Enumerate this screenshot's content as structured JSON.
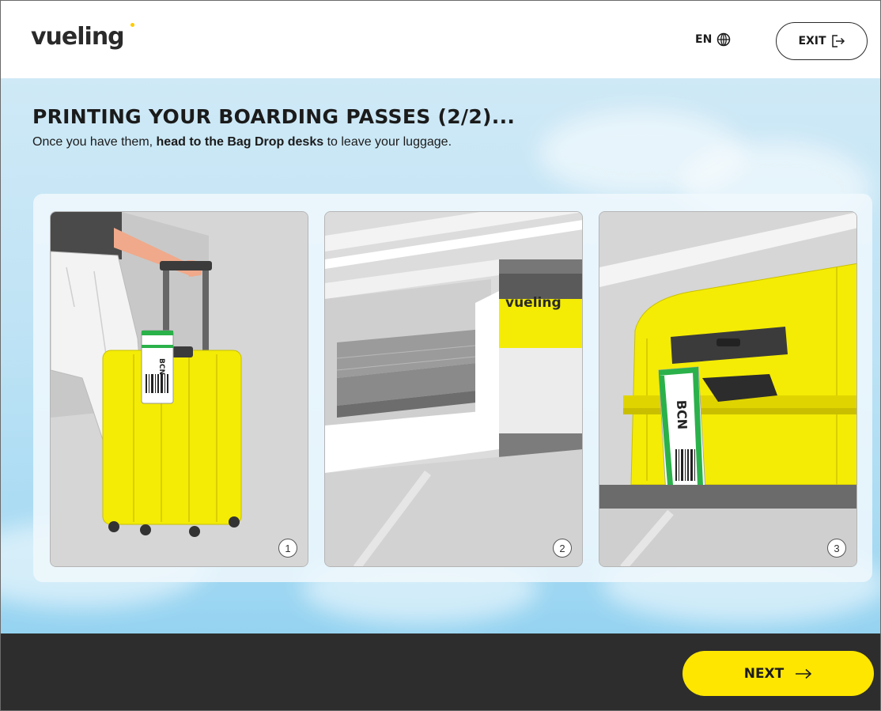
{
  "header": {
    "logo": "vueling",
    "language": "EN",
    "exit_label": "EXIT"
  },
  "main": {
    "title": "PRINTING YOUR BOARDING PASSES (2/2)...",
    "subtitle_before": "Once you have them, ",
    "subtitle_bold": "head to the Bag Drop desks",
    "subtitle_after": " to leave your luggage.",
    "steps": [
      {
        "number": "1",
        "tag_text": "BCN"
      },
      {
        "number": "2",
        "desk_logo": "vueling"
      },
      {
        "number": "3",
        "tag_text": "BCN"
      }
    ]
  },
  "footer": {
    "next_label": "NEXT"
  },
  "colors": {
    "brand_yellow": "#ffe600",
    "footer_bg": "#2d2d2d",
    "text": "#1b1b1b"
  },
  "icons": {
    "language": "globe-icon",
    "exit": "exit-icon",
    "next": "arrow-right-icon"
  }
}
